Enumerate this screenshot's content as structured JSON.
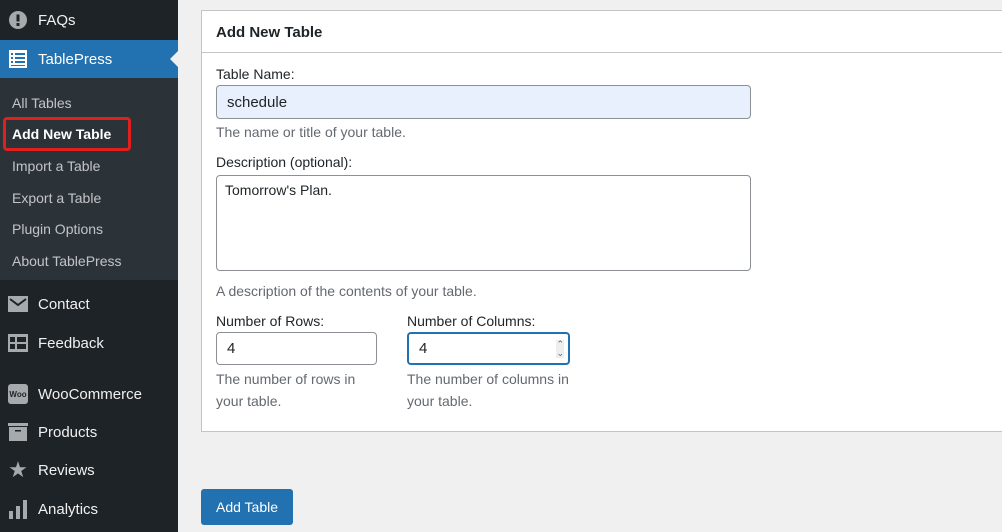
{
  "sidebar": {
    "faqs": "FAQs",
    "tablepress": "TablePress",
    "submenu": [
      "All Tables",
      "Add New Table",
      "Import a Table",
      "Export a Table",
      "Plugin Options",
      "About TablePress"
    ],
    "contact": "Contact",
    "feedback": "Feedback",
    "woocommerce": "WooCommerce",
    "woo_icon": "Woo",
    "products": "Products",
    "reviews": "Reviews",
    "analytics": "Analytics"
  },
  "panel": {
    "title": "Add New Table",
    "name_label": "Table Name:",
    "name_value": "schedule",
    "name_desc": "The name or title of your table.",
    "desc_label": "Description (optional):",
    "desc_value": "Tomorrow's Plan.",
    "desc_desc": "A description of the contents of your table.",
    "rows_label": "Number of Rows:",
    "rows_value": "4",
    "rows_desc": "The number of rows in your table.",
    "cols_label": "Number of Columns:",
    "cols_value": "4",
    "cols_desc": "The number of columns in your table."
  },
  "submit": "Add Table"
}
